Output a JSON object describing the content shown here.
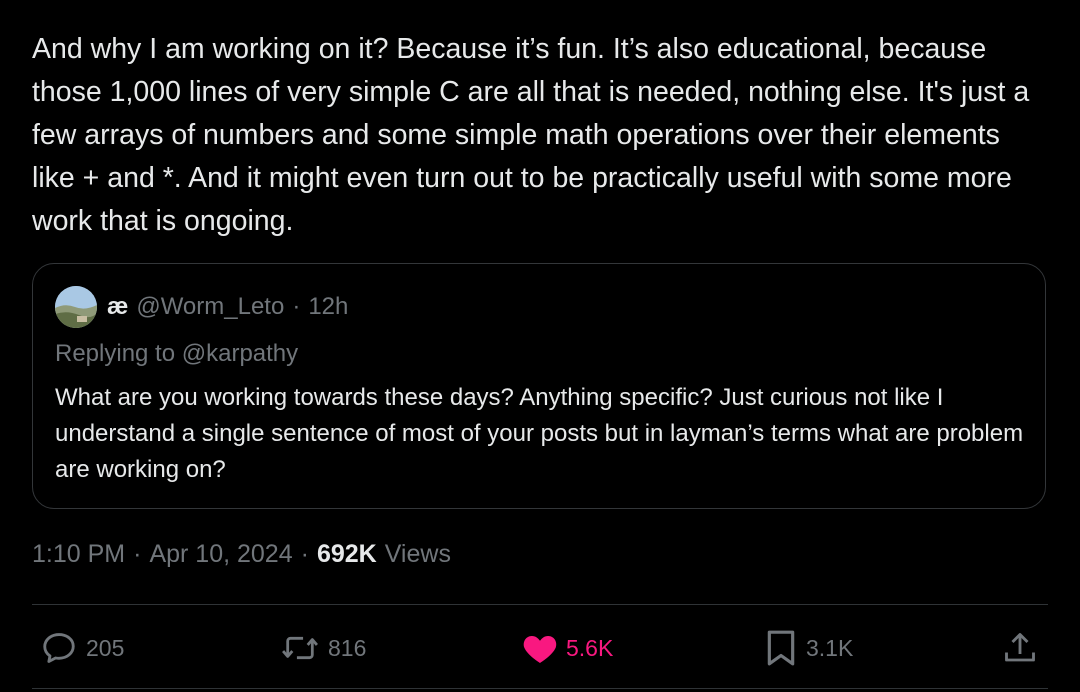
{
  "tweet": {
    "text": "And why I am working on it? Because it’s fun. It’s also educational, because those 1,000 lines of very simple C are all that is needed, nothing else. It's just a few arrays of numbers and some simple math operations over their elements like + and *. And it might even turn out to be practically useful with some more work that is ongoing."
  },
  "quote": {
    "display_name": "æ",
    "handle": "@Worm_Leto",
    "separator": "·",
    "time": "12h",
    "replying_to": "Replying to @karpathy",
    "text": "What are you working towards these days? Anything specific? Just curious not like I understand a single sentence of most of your posts but in layman’s terms what are problem are working on?"
  },
  "meta": {
    "time": "1:10 PM",
    "separator": "·",
    "date": "Apr 10, 2024",
    "views_count": "692K",
    "views_label": "Views"
  },
  "actions": {
    "replies": "205",
    "reposts": "816",
    "likes": "5.6K",
    "bookmarks": "3.1K"
  },
  "icons": {
    "reply": "reply-icon",
    "repost": "repost-icon",
    "like": "heart-icon",
    "bookmark": "bookmark-icon",
    "share": "share-icon"
  },
  "colors": {
    "background": "#000000",
    "text": "#e7e9ea",
    "muted": "#71767b",
    "like": "#f91880",
    "border": "#333639"
  }
}
